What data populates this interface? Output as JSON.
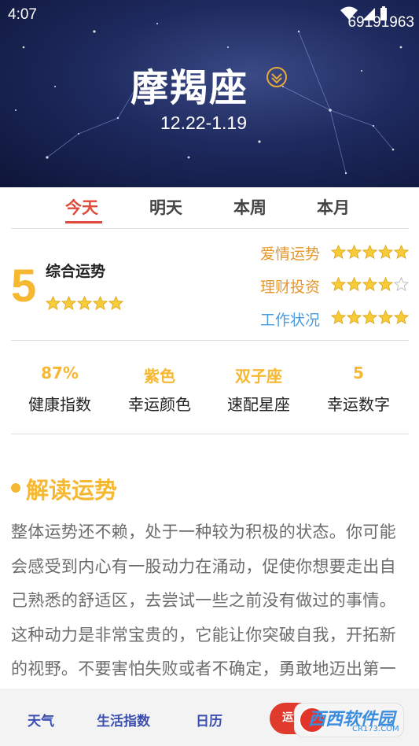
{
  "status_bar": {
    "time": "4:07",
    "id_text": "69191963"
  },
  "header": {
    "sign": "摩羯座",
    "dates": "12.22-1.19"
  },
  "tabs": [
    {
      "label": "今天",
      "active": true
    },
    {
      "label": "明天",
      "active": false
    },
    {
      "label": "本周",
      "active": false
    },
    {
      "label": "本月",
      "active": false
    }
  ],
  "overall": {
    "score": "5",
    "label": "综合运势",
    "stars": 5
  },
  "fortunes": [
    {
      "label": "爱情运势",
      "stars": 5,
      "color": "#e8962a"
    },
    {
      "label": "理财投资",
      "stars": 4,
      "color": "#e8962a"
    },
    {
      "label": "工作状况",
      "stars": 5,
      "color": "#4a9be0"
    }
  ],
  "stats": [
    {
      "value": "87%",
      "label": "健康指数"
    },
    {
      "value": "紫色",
      "label": "幸运颜色"
    },
    {
      "value": "双子座",
      "label": "速配星座"
    },
    {
      "value": "5",
      "label": "幸运数字"
    }
  ],
  "interpretation": {
    "title": "解读运势",
    "body": "整体运势还不赖，处于一种较为积极的状态。你可能会感受到内心有一股动力在涌动，促使你想要走出自己熟悉的舒适区，去尝试一些之前没有做过的事情。这种动力是非常宝贵的，它能让你突破自我，开拓新的视野。不要害怕失败或者不确定，勇敢地迈出第一步，去探索未知的领域。"
  },
  "bottom_nav": {
    "items": [
      "天气",
      "生活指数",
      "日历"
    ],
    "fab_label": "运势"
  },
  "watermark": {
    "text": "西西软件园",
    "sub": "CR173.COM"
  },
  "colors": {
    "accent": "#e04a3b",
    "gold": "#f6b731",
    "nav": "#3c4fb0"
  }
}
